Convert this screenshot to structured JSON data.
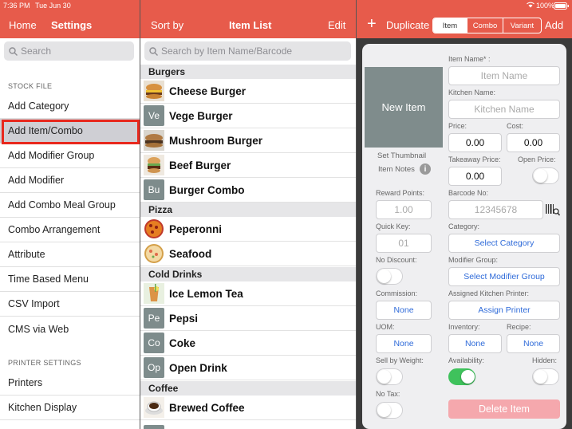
{
  "status": {
    "time": "7:36 PM",
    "date": "Tue Jun 30",
    "battery": "100%"
  },
  "colors": {
    "header": "#e75b4b",
    "highlight": "#e8281d",
    "accent_blue": "#2f6bd9",
    "toggle_on": "#3fc25c",
    "delete": "#f5a8ad"
  },
  "left": {
    "home": "Home",
    "title": "Settings",
    "search_placeholder": "Search",
    "stock_file_header": "STOCK FILE",
    "items": [
      "Add Category",
      "Add Item/Combo",
      "Add Modifier Group",
      "Add Modifier",
      "Add Combo Meal Group",
      "Combo Arrangement",
      "Attribute",
      "Time Based Menu",
      "CSV Import",
      "CMS via Web"
    ],
    "selected_item": "Add Item/Combo",
    "printer_settings_header": "PRINTER SETTINGS",
    "printer_items": [
      "Printers",
      "Kitchen Display"
    ]
  },
  "middle": {
    "sort_by": "Sort by",
    "title": "Item List",
    "edit": "Edit",
    "search_placeholder": "Search by Item Name/Barcode",
    "groups": [
      {
        "name": "Burgers",
        "items": [
          {
            "name": "Cheese Burger",
            "thumb": "burger-photo"
          },
          {
            "name": "Vege Burger",
            "thumb": "Ve"
          },
          {
            "name": "Mushroom Burger",
            "thumb": "mushroom-burger-photo"
          },
          {
            "name": "Beef Burger",
            "thumb": "beef-burger-photo"
          },
          {
            "name": "Burger Combo",
            "thumb": "Bu"
          }
        ]
      },
      {
        "name": "Pizza",
        "items": [
          {
            "name": "Peperonni",
            "thumb": "pizza-photo"
          },
          {
            "name": "Seafood",
            "thumb": "seafood-pizza-photo"
          }
        ]
      },
      {
        "name": "Cold Drinks",
        "items": [
          {
            "name": "Ice Lemon Tea",
            "thumb": "lemon-tea-photo"
          },
          {
            "name": "Pepsi",
            "thumb": "Pe"
          },
          {
            "name": "Coke",
            "thumb": "Co"
          },
          {
            "name": "Open Drink",
            "thumb": "Op"
          }
        ]
      },
      {
        "name": "Coffee",
        "items": [
          {
            "name": "Brewed Coffee",
            "thumb": "coffee-photo"
          }
        ]
      }
    ]
  },
  "right": {
    "duplicate": "Duplicate",
    "add": "Add",
    "tabs": [
      "Item",
      "Combo",
      "Variant"
    ],
    "active_tab": "Item",
    "new_item": "New Item",
    "set_thumbnail": "Set Thumbnail",
    "item_notes": "Item Notes",
    "item_name_label": "Item Name* :",
    "item_name_placeholder": "Item Name",
    "kitchen_name_label": "Kitchen Name:",
    "kitchen_name_placeholder": "Kitchen Name",
    "price_label": "Price:",
    "price_value": "0.00",
    "cost_label": "Cost:",
    "cost_value": "0.00",
    "takeaway_label": "Takeaway Price:",
    "takeaway_value": "0.00",
    "open_price_label": "Open Price:",
    "reward_label": "Reward Points:",
    "reward_placeholder": "1.00",
    "barcode_label": "Barcode No:",
    "barcode_placeholder": "12345678",
    "quick_key_label": "Quick Key:",
    "quick_key_placeholder": "01",
    "category_label": "Category:",
    "category_button": "Select Category",
    "no_discount_label": "No Discount:",
    "modifier_group_label": "Modifier Group:",
    "modifier_group_button": "Select Modifier Group",
    "commission_label": "Commission:",
    "commission_value": "None",
    "kitchen_printer_label": "Assigned Kitchen Printer:",
    "kitchen_printer_button": "Assign Printer",
    "uom_label": "UOM:",
    "uom_value": "None",
    "inventory_label": "Inventory:",
    "inventory_value": "None",
    "recipe_label": "Recipe:",
    "recipe_value": "None",
    "sell_by_weight_label": "Sell by Weight:",
    "availability_label": "Availability:",
    "hidden_label": "Hidden:",
    "no_tax_label": "No Tax:",
    "delete_button": "Delete Item",
    "toggles": {
      "open_price": false,
      "no_discount": false,
      "sell_by_weight": false,
      "availability": true,
      "hidden": false,
      "no_tax": false
    }
  }
}
